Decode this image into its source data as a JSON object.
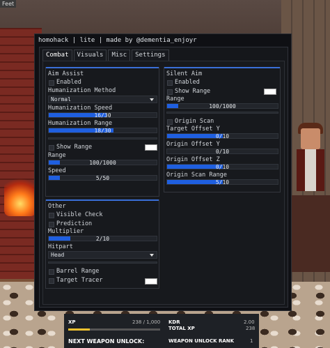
{
  "background": {
    "corner_tag": "Feet"
  },
  "window": {
    "title": "homohack | lite | made by @dementia_enjoyr",
    "tabs": [
      "Combat",
      "Visuals",
      "Misc",
      "Settings"
    ],
    "active_tab": "Combat"
  },
  "aim_assist": {
    "header": "Aim Assist",
    "enabled_label": "Enabled",
    "method_label": "Humanization Method",
    "method_value": "Normal",
    "speed_label": "Humanization Speed",
    "speed_value": "16/30",
    "speed_fraction": 0.533,
    "range_label": "Humanization Range",
    "range_value": "18/30",
    "range_fraction": 0.6,
    "show_range_label": "Show Range",
    "range2_label": "Range",
    "range2_value": "100/1000",
    "range2_fraction": 0.1,
    "aspeed_label": "Speed",
    "aspeed_value": "5/50",
    "aspeed_fraction": 0.1
  },
  "other": {
    "header": "Other",
    "visible_check_label": "Visible Check",
    "prediction_label": "Prediction",
    "multiplier_label": "Multiplier",
    "multiplier_value": "2/10",
    "multiplier_fraction": 0.2,
    "hitpart_label": "Hitpart",
    "hitpart_value": "Head",
    "barrel_label": "Barrel Range",
    "tracer_label": "Target Tracer"
  },
  "silent_aim": {
    "header": "Silent Aim",
    "enabled_label": "Enabled",
    "show_range_label": "Show Range",
    "range_label": "Range",
    "range_value": "100/1000",
    "range_fraction": 0.1,
    "origin_scan_label": "Origin Scan",
    "target_offset_y_label": "Target Offset Y",
    "target_offset_y_value": "0/10",
    "target_offset_y_fraction": 0.5,
    "origin_offset_y_label": "Origin Offset Y",
    "origin_offset_y_value": "0/10",
    "origin_offset_y_fraction": 0.0,
    "origin_offset_z_label": "Origin Offset Z",
    "origin_offset_z_value": "0/10",
    "origin_offset_z_fraction": 0.5,
    "origin_scan_range_label": "Origin Scan Range",
    "origin_scan_range_value": "5/10",
    "origin_scan_range_fraction": 0.5
  },
  "stats": {
    "xp_label": "XP",
    "xp_value": "238 / 1,000",
    "xp_fraction": 0.238,
    "kdr_label": "KDR",
    "kdr_value": "2.00",
    "total_xp_label": "TOTAL XP",
    "total_xp_value": "238",
    "next_unlock_label": "NEXT WEAPON UNLOCK:",
    "unlock_rank_label": "WEAPON UNLOCK RANK",
    "unlock_rank_value": "1"
  },
  "colors": {
    "accent": "#1f5fe0",
    "header_line": "#3a6fd8",
    "panel": "#17191d"
  }
}
